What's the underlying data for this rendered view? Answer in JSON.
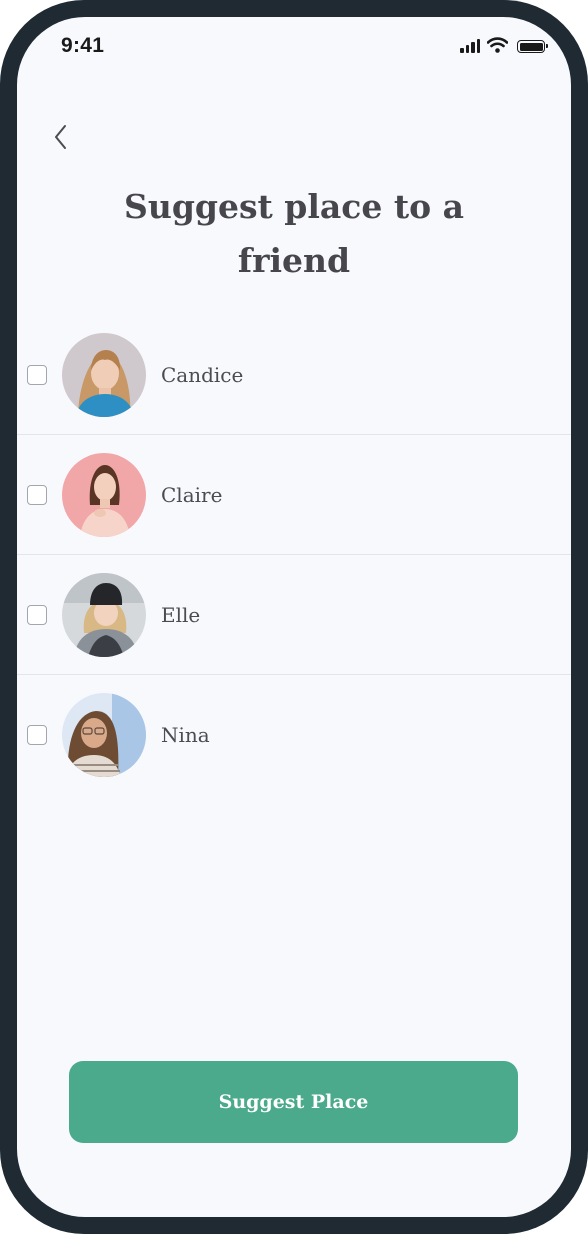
{
  "status_bar": {
    "time": "9:41",
    "icons": [
      "cellular-signal-icon",
      "wifi-icon",
      "battery-icon"
    ]
  },
  "header": {
    "back_icon": "chevron-left-icon",
    "title": "Suggest place to a friend"
  },
  "friends": [
    {
      "name": "Candice",
      "checked": false
    },
    {
      "name": "Claire",
      "checked": false
    },
    {
      "name": "Elle",
      "checked": false
    },
    {
      "name": "Nina",
      "checked": false
    }
  ],
  "actions": {
    "suggest_label": "Suggest Place"
  },
  "colors": {
    "primary": "#4aaa8b",
    "background": "#f8f9fd",
    "text": "#46464c",
    "divider": "#e3e5ea",
    "device_frame": "#1f2a33"
  }
}
